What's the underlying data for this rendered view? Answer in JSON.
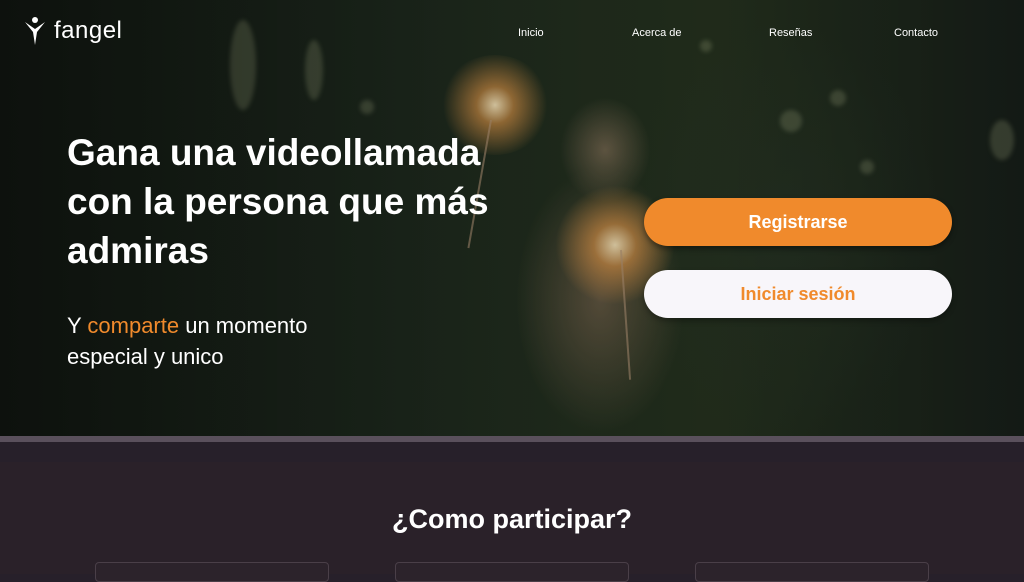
{
  "brand": {
    "name": "fangel"
  },
  "nav": {
    "items": [
      "Inicio",
      "Acerca de",
      "Reseñas",
      "Contacto"
    ]
  },
  "hero": {
    "headline": "Gana una videollamada con la persona que más admiras",
    "sub_prefix": "Y ",
    "sub_accent": "comparte",
    "sub_suffix": " un momento especial y unico",
    "register_label": "Registrarse",
    "login_label": "Iniciar sesión"
  },
  "section": {
    "title": "¿Como participar?"
  },
  "colors": {
    "accent": "#f08a2c",
    "background": "#2a2129",
    "text": "#ffffff"
  }
}
